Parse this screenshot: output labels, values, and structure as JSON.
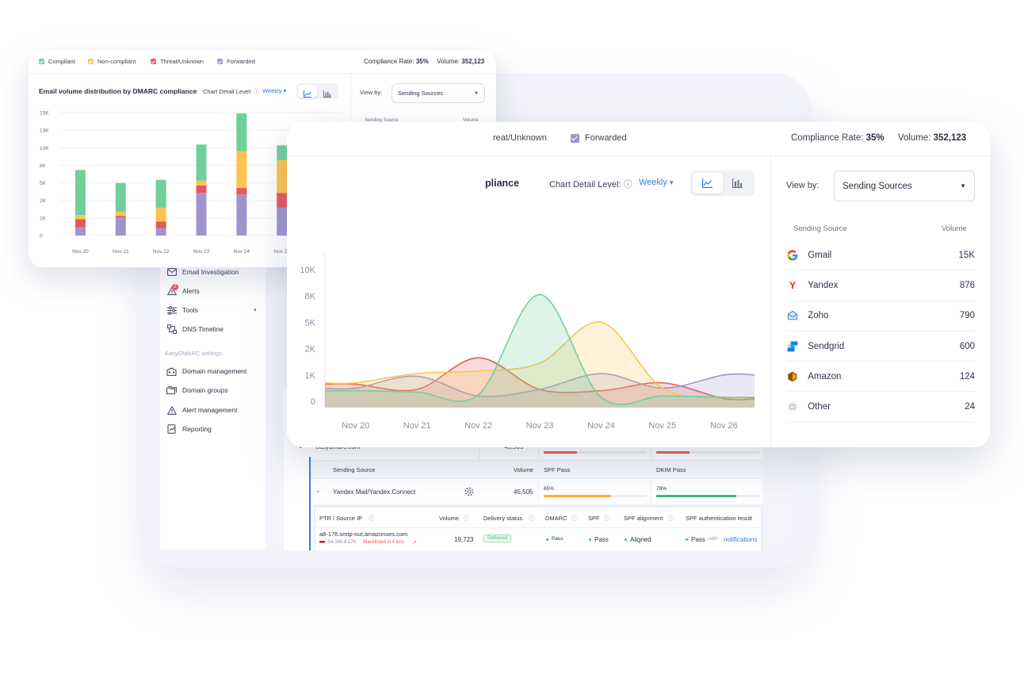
{
  "colors": {
    "compliant": "#6fcf9d",
    "noncompliant": "#fec350",
    "threat": "#e4585d",
    "forwarded": "#a194ce",
    "accent": "#3a7bd5"
  },
  "legend": [
    "Compliant",
    "Non-compliant",
    "Threat/Unknown",
    "Forwarded"
  ],
  "summary": {
    "compliance_label": "Compliance Rate:",
    "compliance_value": "35%",
    "volume_label": "Volume:",
    "volume_value": "352,123"
  },
  "chart_title": "Email volume distribution by DMARC compliance",
  "big_chart_title_partial": "pliance",
  "detail_label": "Chart Detail Level:",
  "detail_value": "Weekly",
  "view_by_label": "View by:",
  "view_by_value": "Sending Sources",
  "big_legend": [
    "reat/Unknown",
    "Forwarded"
  ],
  "sources": {
    "header_source": "Sending Source",
    "header_volume": "Volume",
    "items": [
      {
        "name": "Gmail",
        "volume": "15K",
        "icon": "google-icon"
      },
      {
        "name": "Yandex",
        "volume": "876",
        "icon": "yandex-icon"
      },
      {
        "name": "Zoho",
        "volume": "790",
        "icon": "zoho-icon"
      },
      {
        "name": "Sendgrid",
        "volume": "600",
        "icon": "sendgrid-icon"
      },
      {
        "name": "Amazon",
        "volume": "124",
        "icon": "amazon-icon"
      },
      {
        "name": "Other",
        "volume": "24",
        "icon": "other-icon"
      }
    ]
  },
  "chart_data": [
    {
      "type": "bar",
      "stacked": true,
      "categories": [
        "Nov 20",
        "Nov 21",
        "Nov 22",
        "Nov 23",
        "Nov 24",
        "Nov 25",
        "Nov 26"
      ],
      "y_ticks": [
        "15K",
        "13K",
        "10K",
        "8K",
        "5K",
        "2K",
        "1K",
        "0"
      ],
      "series": [
        {
          "name": "Forwarded",
          "values": [
            1000,
            2200,
            900,
            5200,
            5000,
            3400,
            1000
          ]
        },
        {
          "name": "Threat/Unknown",
          "values": [
            1000,
            200,
            800,
            900,
            800,
            1800,
            300
          ]
        },
        {
          "name": "Non-compliant",
          "values": [
            500,
            500,
            1700,
            600,
            4500,
            4000,
            500
          ]
        },
        {
          "name": "Compliant",
          "values": [
            5500,
            3500,
            3400,
            4400,
            4600,
            1800,
            1300
          ]
        }
      ],
      "ylim": [
        0,
        15000
      ]
    },
    {
      "type": "area",
      "categories": [
        "Nov 20",
        "Nov 21",
        "Nov 22",
        "Nov 23",
        "Nov 24",
        "Nov 25",
        "Nov 26"
      ],
      "y_ticks": [
        "10K",
        "8K",
        "5K",
        "2K",
        "1K",
        "0"
      ],
      "series": [
        {
          "name": "Compliant",
          "values": [
            0.8,
            0.7,
            0.5,
            8.1,
            0.3,
            0.4,
            0.3
          ]
        },
        {
          "name": "Non-compliant",
          "values": [
            1.4,
            2.1,
            2.3,
            2.9,
            6.0,
            1.0,
            0.3
          ]
        },
        {
          "name": "Threat/Unknown",
          "values": [
            1.3,
            0.9,
            3.3,
            0.9,
            0.8,
            1.4,
            0.2
          ]
        },
        {
          "name": "Forwarded",
          "values": [
            1.0,
            1.9,
            0.4,
            0.9,
            2.1,
            1.0,
            2.0
          ]
        }
      ],
      "ylim": [
        0,
        10
      ]
    }
  ],
  "sidebar": {
    "items": [
      {
        "label": "Email Investigation",
        "icon": "mail-icon"
      },
      {
        "label": "Alerts",
        "icon": "alert-icon",
        "badge": "2"
      },
      {
        "label": "Tools",
        "icon": "sliders-icon"
      },
      {
        "label": "DNS Timeline",
        "icon": "timeline-icon"
      }
    ],
    "section_label": "EasyDMARC settings",
    "settings_items": [
      {
        "label": "Domain management",
        "icon": "building-icon"
      },
      {
        "label": "Domain groups",
        "icon": "folders-icon"
      },
      {
        "label": "Alert management",
        "icon": "warning-icon"
      },
      {
        "label": "Reporting",
        "icon": "report-icon"
      }
    ]
  },
  "table": {
    "domain_row": {
      "name": "easydmarc.com",
      "volume": "45,505"
    },
    "headers": [
      "Sending Source",
      "Volume",
      "SPF Pass",
      "DKIM Pass"
    ],
    "source_row": {
      "name": "Yandex Mail/Yandex.Connect",
      "volume": "45,505",
      "spf_pct": "65%",
      "spf_fill": 0.65,
      "dkim_pct": "78%",
      "dkim_fill": 0.78
    },
    "detail_headers": [
      "PTR / Source IP",
      "Volume",
      "Delivery status",
      "DMARC",
      "SPF",
      "SPF alignment",
      "SPF authentication result"
    ],
    "detail_row": {
      "host": "a8-176.smtp-out.amazonses.com",
      "ip": "54.240.8.176",
      "blacklist": "Blacklisted in 4 lists",
      "volume": "19,723",
      "delivery": "Delivered",
      "dmarc": "Pass",
      "spf": "Pass",
      "alignment": "Aligned",
      "auth_result": "Pass",
      "with": "with",
      "auth_domain": "notifications"
    }
  }
}
